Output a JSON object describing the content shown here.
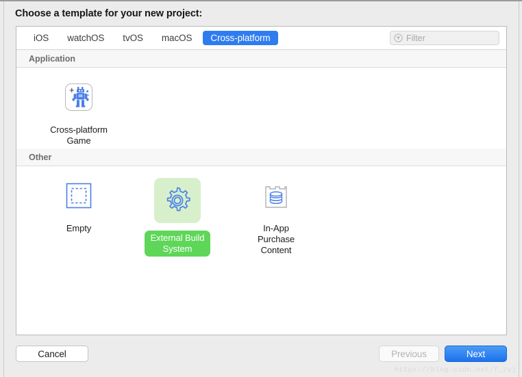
{
  "dialog": {
    "title": "Choose a template for your new project:"
  },
  "tabs": [
    {
      "label": "iOS",
      "selected": false
    },
    {
      "label": "watchOS",
      "selected": false
    },
    {
      "label": "tvOS",
      "selected": false
    },
    {
      "label": "macOS",
      "selected": false
    },
    {
      "label": "Cross-platform",
      "selected": true
    }
  ],
  "filter": {
    "placeholder": "Filter",
    "value": "",
    "icon": "filter-icon"
  },
  "sections": [
    {
      "title": "Application",
      "templates": [
        {
          "label": "Cross-platform\nGame",
          "icon": "game-robot-icon",
          "selected": false
        }
      ]
    },
    {
      "title": "Other",
      "templates": [
        {
          "label": "Empty",
          "icon": "empty-dashed-square-icon",
          "selected": false
        },
        {
          "label": "External Build\nSystem",
          "icon": "gear-icon",
          "selected": true
        },
        {
          "label": "In-App Purchase\nContent",
          "icon": "coin-stack-box-icon",
          "selected": false
        }
      ]
    }
  ],
  "footer": {
    "cancel_label": "Cancel",
    "previous_label": "Previous",
    "next_label": "Next"
  },
  "watermark": "https://blog.csdn.net/f_zyj",
  "colors": {
    "accent_blue": "#2f7cf0",
    "selection_green": "#5ed658",
    "selection_green_tint": "#d7f0cb",
    "icon_blue": "#4a7fe8",
    "panel_background": "#ffffff",
    "window_background": "#ececec"
  }
}
